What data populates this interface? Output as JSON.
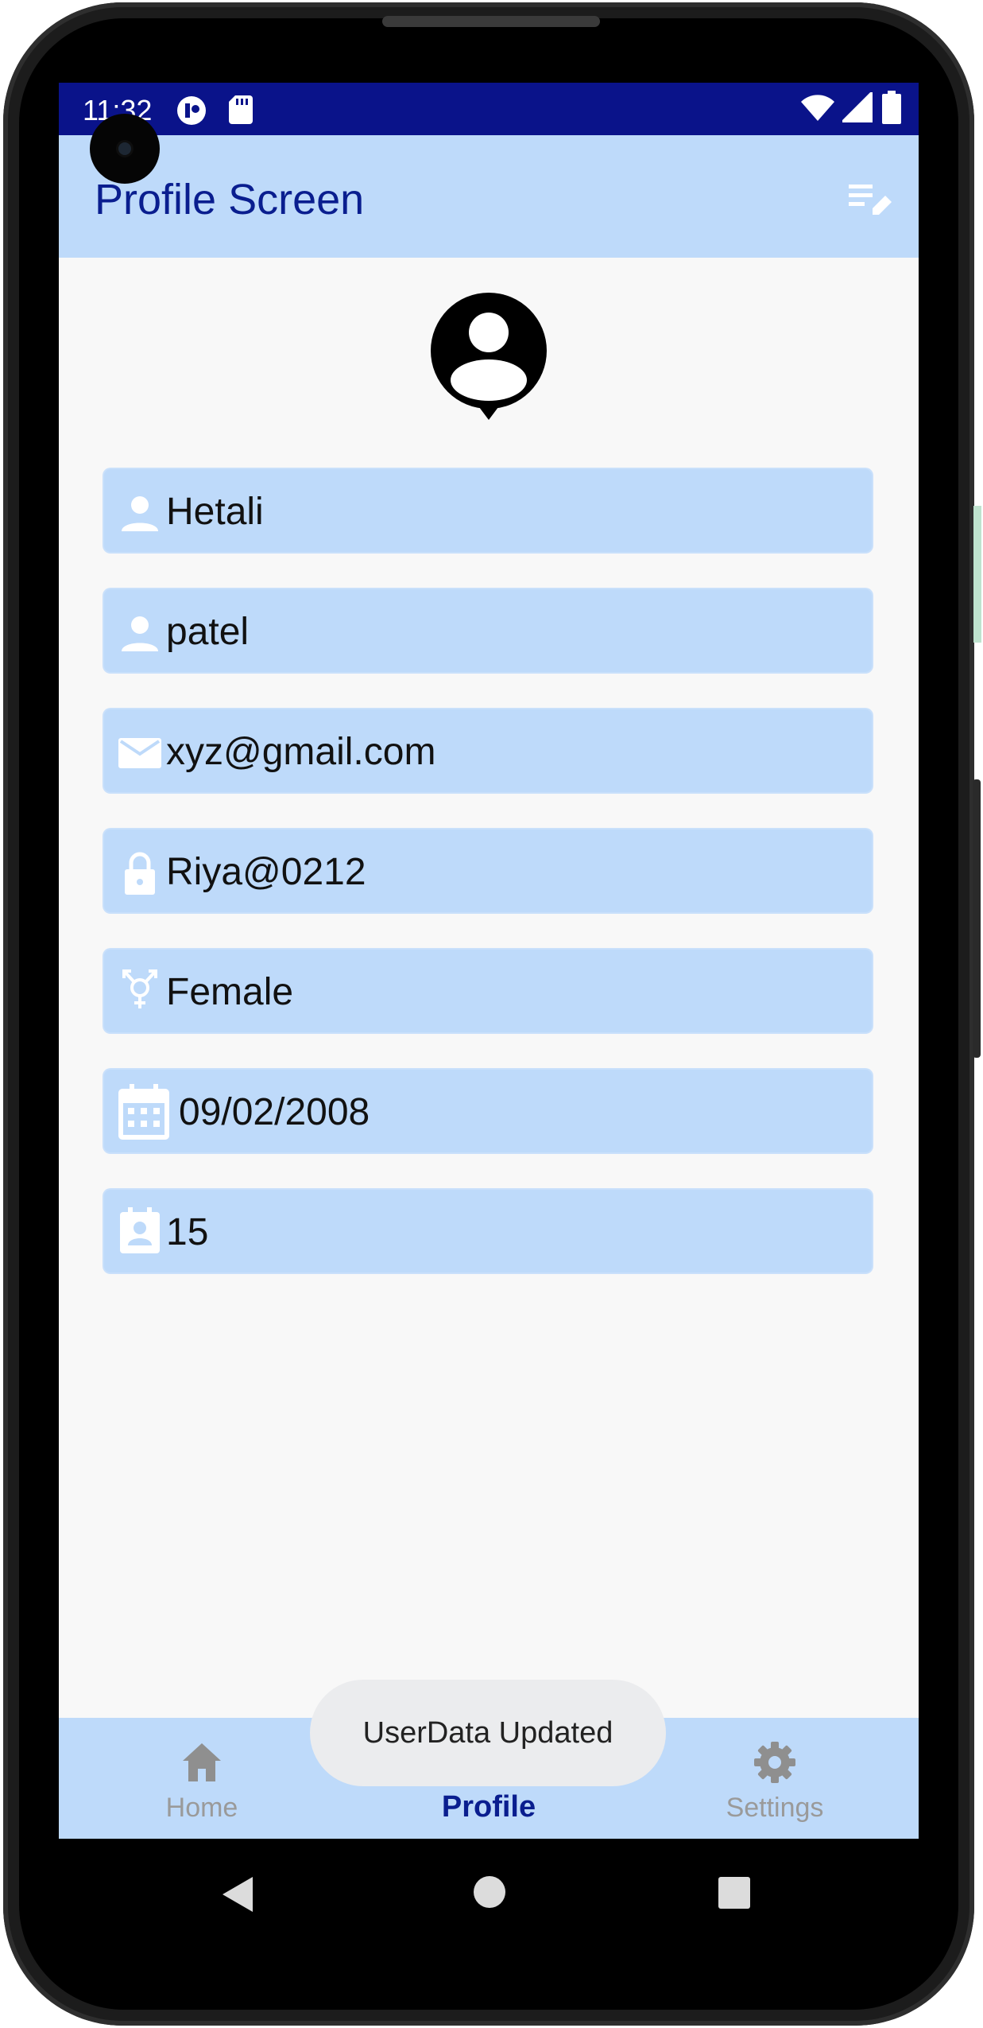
{
  "status_bar": {
    "time": "11:32",
    "icons_left": [
      "app-badge-icon",
      "sd-card-icon"
    ],
    "icons_right": [
      "wifi-icon",
      "signal-icon",
      "battery-icon"
    ]
  },
  "app_bar": {
    "title": "Profile Screen",
    "action_icon": "edit-list-icon"
  },
  "profile": {
    "avatar_icon": "account-pin-icon",
    "fields": [
      {
        "icon": "person-icon",
        "value": "Hetali"
      },
      {
        "icon": "person-icon",
        "value": "patel"
      },
      {
        "icon": "email-icon",
        "value": "xyz@gmail.com"
      },
      {
        "icon": "lock-icon",
        "value": "Riya@0212"
      },
      {
        "icon": "gender-icon",
        "value": "Female"
      },
      {
        "icon": "calendar-icon",
        "value": "09/02/2008"
      },
      {
        "icon": "contact-badge-icon",
        "value": "15"
      }
    ]
  },
  "bottom_nav": {
    "items": [
      {
        "label": "Home",
        "icon": "home-icon",
        "active": false
      },
      {
        "label": "Profile",
        "icon": "person-icon",
        "active": true
      },
      {
        "label": "Settings",
        "icon": "settings-gear-icon",
        "active": false
      }
    ]
  },
  "toast": {
    "message": "UserData Updated"
  },
  "system_nav": {
    "icons": [
      "back-icon",
      "home-circle-icon",
      "recents-icon"
    ]
  },
  "colors": {
    "status_bar": "#0a138a",
    "app_bar": "#bedafa",
    "title_text": "#0a1e8f",
    "field_background": "#bedafa",
    "screen_background": "#f8f8f8",
    "nav_inactive": "#9a9a9a"
  }
}
